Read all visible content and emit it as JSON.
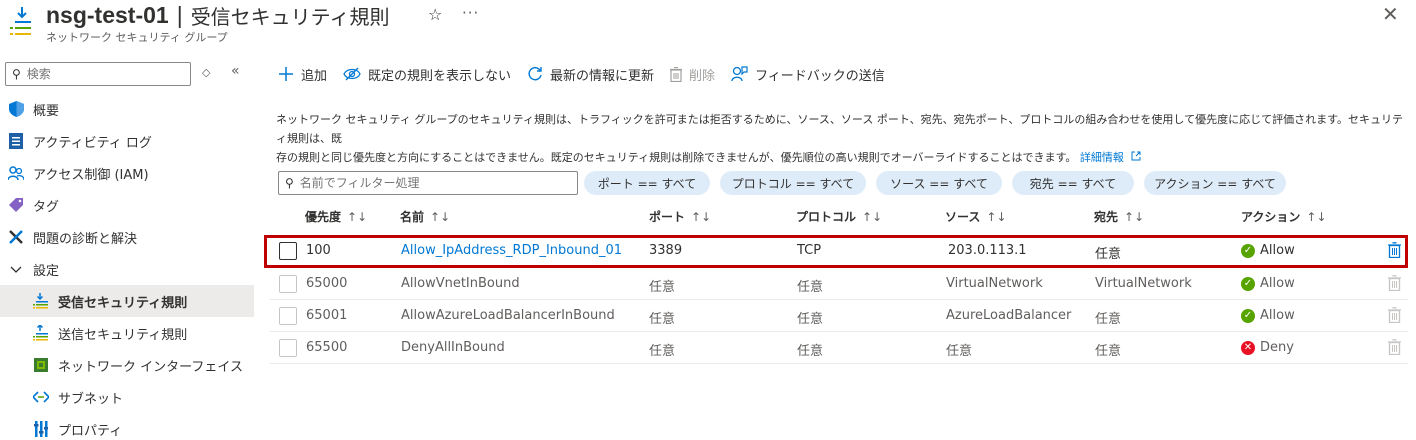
{
  "header": {
    "resource_name": "nsg-test-01",
    "separator": "|",
    "page_title": "受信セキュリティ規則",
    "subtitle": "ネットワーク セキュリティ グループ",
    "favorite_icon": "star-icon",
    "more_icon": "ellipsis-icon",
    "close_icon": "close-icon"
  },
  "sidebar": {
    "search_placeholder": "検索",
    "items": [
      {
        "label": "概要",
        "icon": "shield-icon"
      },
      {
        "label": "アクティビティ ログ",
        "icon": "activity-log-icon"
      },
      {
        "label": "アクセス制御 (IAM)",
        "icon": "people-icon"
      },
      {
        "label": "タグ",
        "icon": "tag-icon"
      },
      {
        "label": "問題の診断と解決",
        "icon": "wrench-icon"
      },
      {
        "label": "設定",
        "icon": "chevron-down-icon"
      },
      {
        "label": "受信セキュリティ規則",
        "icon": "inbound-rules-icon"
      },
      {
        "label": "送信セキュリティ規則",
        "icon": "outbound-rules-icon"
      },
      {
        "label": "ネットワーク インターフェイス",
        "icon": "nic-icon"
      },
      {
        "label": "サブネット",
        "icon": "subnet-icon"
      },
      {
        "label": "プロパティ",
        "icon": "properties-icon"
      }
    ]
  },
  "toolbar": {
    "add": "追加",
    "hide_default": "既定の規則を表示しない",
    "refresh": "最新の情報に更新",
    "delete": "削除",
    "feedback": "フィードバックの送信"
  },
  "description": {
    "line1": "ネットワーク セキュリティ グループのセキュリティ規則は、トラフィックを許可または拒否するために、ソース、ソース ポート、宛先、宛先ポート、プロトコルの組み合わせを使用して優先度に応じて評価されます。セキュリティ規則は、既",
    "line2": "存の規則と同じ優先度と方向にすることはできません。既定のセキュリティ規則は削除できませんが、優先順位の高い規則でオーバーライドすることはできます。",
    "link": "詳細情報"
  },
  "filters": {
    "name_placeholder": "名前でフィルター処理",
    "port": "ポート == すべて",
    "protocol": "プロトコル == すべて",
    "source": "ソース == すべて",
    "destination": "宛先 == すべて",
    "action": "アクション == すべて"
  },
  "table": {
    "columns": [
      "優先度",
      "名前",
      "ポート",
      "プロトコル",
      "ソース",
      "宛先",
      "アクション"
    ],
    "sort_glyph": "↑↓",
    "rows": [
      {
        "priority": "100",
        "name": "Allow_IpAddress_RDP_Inbound_01",
        "port": "3389",
        "protocol": "TCP",
        "source": "203.0.113.1",
        "destination": "任意",
        "action": "Allow"
      },
      {
        "priority": "65000",
        "name": "AllowVnetInBound",
        "port": "任意",
        "protocol": "任意",
        "source": "VirtualNetwork",
        "destination": "VirtualNetwork",
        "action": "Allow"
      },
      {
        "priority": "65001",
        "name": "AllowAzureLoadBalancerInBound",
        "port": "任意",
        "protocol": "任意",
        "source": "AzureLoadBalancer",
        "destination": "任意",
        "action": "Allow"
      },
      {
        "priority": "65500",
        "name": "DenyAllInBound",
        "port": "任意",
        "protocol": "任意",
        "source": "任意",
        "destination": "任意",
        "action": "Deny"
      }
    ]
  },
  "colors": {
    "accent": "#0078d4",
    "allow": "#57a300",
    "deny": "#e81123",
    "highlight": "#c00000",
    "pill": "#deecf9"
  }
}
